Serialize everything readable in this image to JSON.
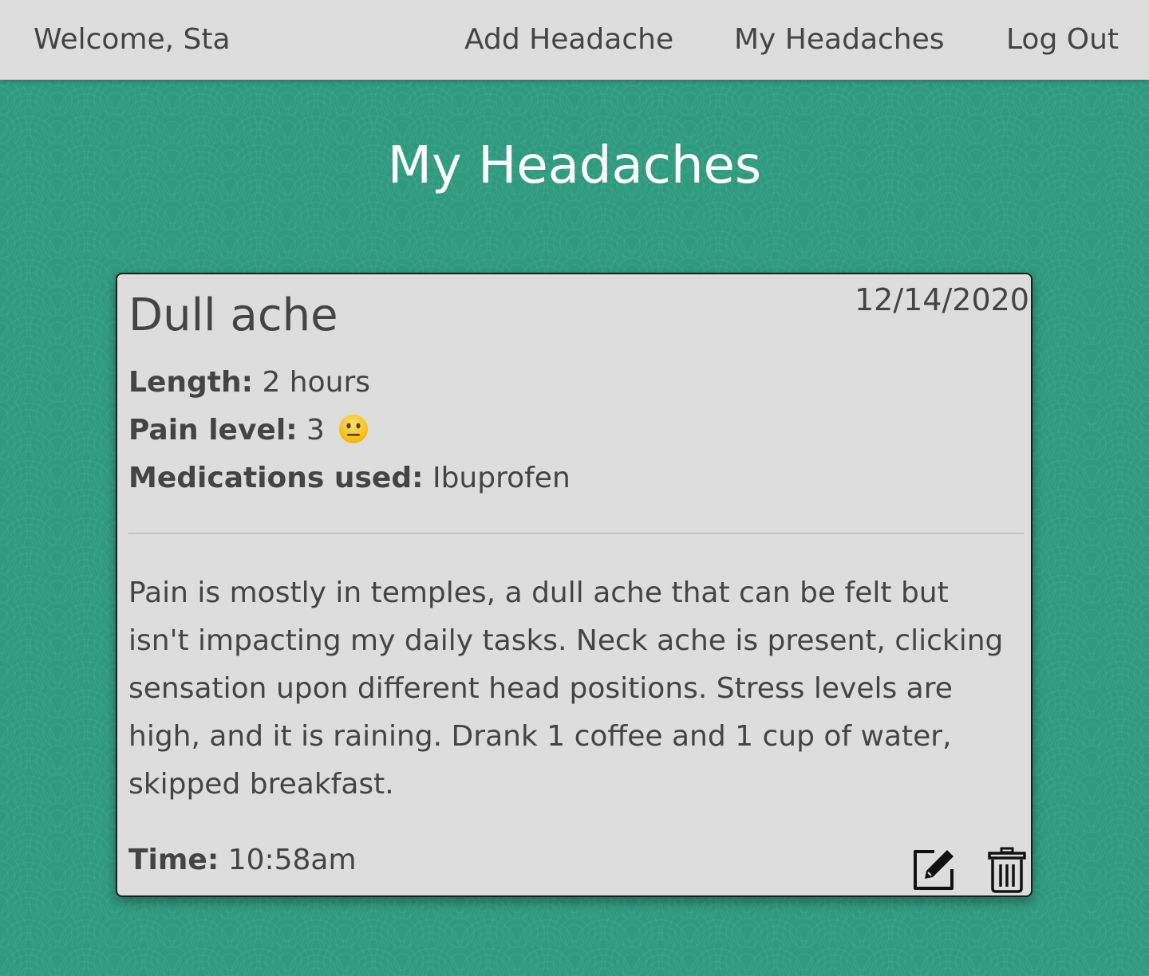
{
  "nav": {
    "welcome": "Welcome, Sta",
    "add_headache": "Add Headache",
    "my_headaches": "My Headaches",
    "log_out": "Log Out"
  },
  "page": {
    "title": "My Headaches"
  },
  "headache": {
    "title": "Dull ache",
    "date": "12/14/2020",
    "length_label": "Length:",
    "length_value": "2 hours",
    "pain_label": "Pain level:",
    "pain_value": "3",
    "pain_icon": "neutral-face-emoji",
    "meds_label": "Medications used:",
    "meds_value": "Ibuprofen",
    "notes": "Pain is mostly in temples, a dull ache that can be felt but isn't impacting my daily tasks. Neck ache is present, clicking sensation upon different head positions. Stress levels are high, and it is raining. Drank 1 coffee and 1 cup of water, skipped breakfast.",
    "time_label": "Time:",
    "time_value": "10:58am"
  },
  "colors": {
    "background": "#2f9a80",
    "navbar": "#dddddd",
    "card": "#dddddd",
    "text": "#444444",
    "title": "#ffffff"
  }
}
